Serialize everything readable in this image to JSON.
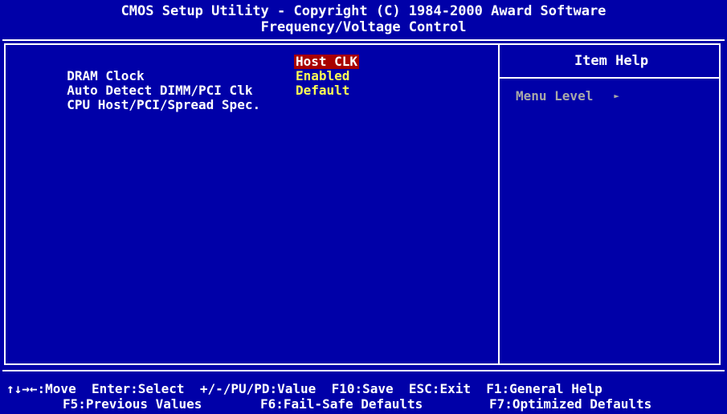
{
  "header": {
    "line1": "CMOS Setup Utility - Copyright (C) 1984-2000 Award Software",
    "line2": "Frequency/Voltage Control"
  },
  "settings": [
    {
      "label": "DRAM Clock",
      "value": "Host CLK",
      "selected": true
    },
    {
      "label": "Auto Detect DIMM/PCI Clk",
      "value": "Enabled",
      "selected": false
    },
    {
      "label": "CPU Host/PCI/Spread Spec.",
      "value": "Default",
      "selected": false
    }
  ],
  "help": {
    "title": "Item Help",
    "menu_level": "Menu Level",
    "arrow_icon": "►"
  },
  "footer": {
    "line1": "↑↓→←:Move  Enter:Select  +/-/PU/PD:Value  F10:Save  ESC:Exit  F1:General Help",
    "line2_a": "F5:Previous Values",
    "line2_b": "F6:Fail-Safe Defaults",
    "line2_c": "F7:Optimized Defaults"
  },
  "colors": {
    "background": "#0000a8",
    "value": "#ffff54",
    "selected_bg": "#a80000",
    "disabled": "#a8a8a8"
  }
}
